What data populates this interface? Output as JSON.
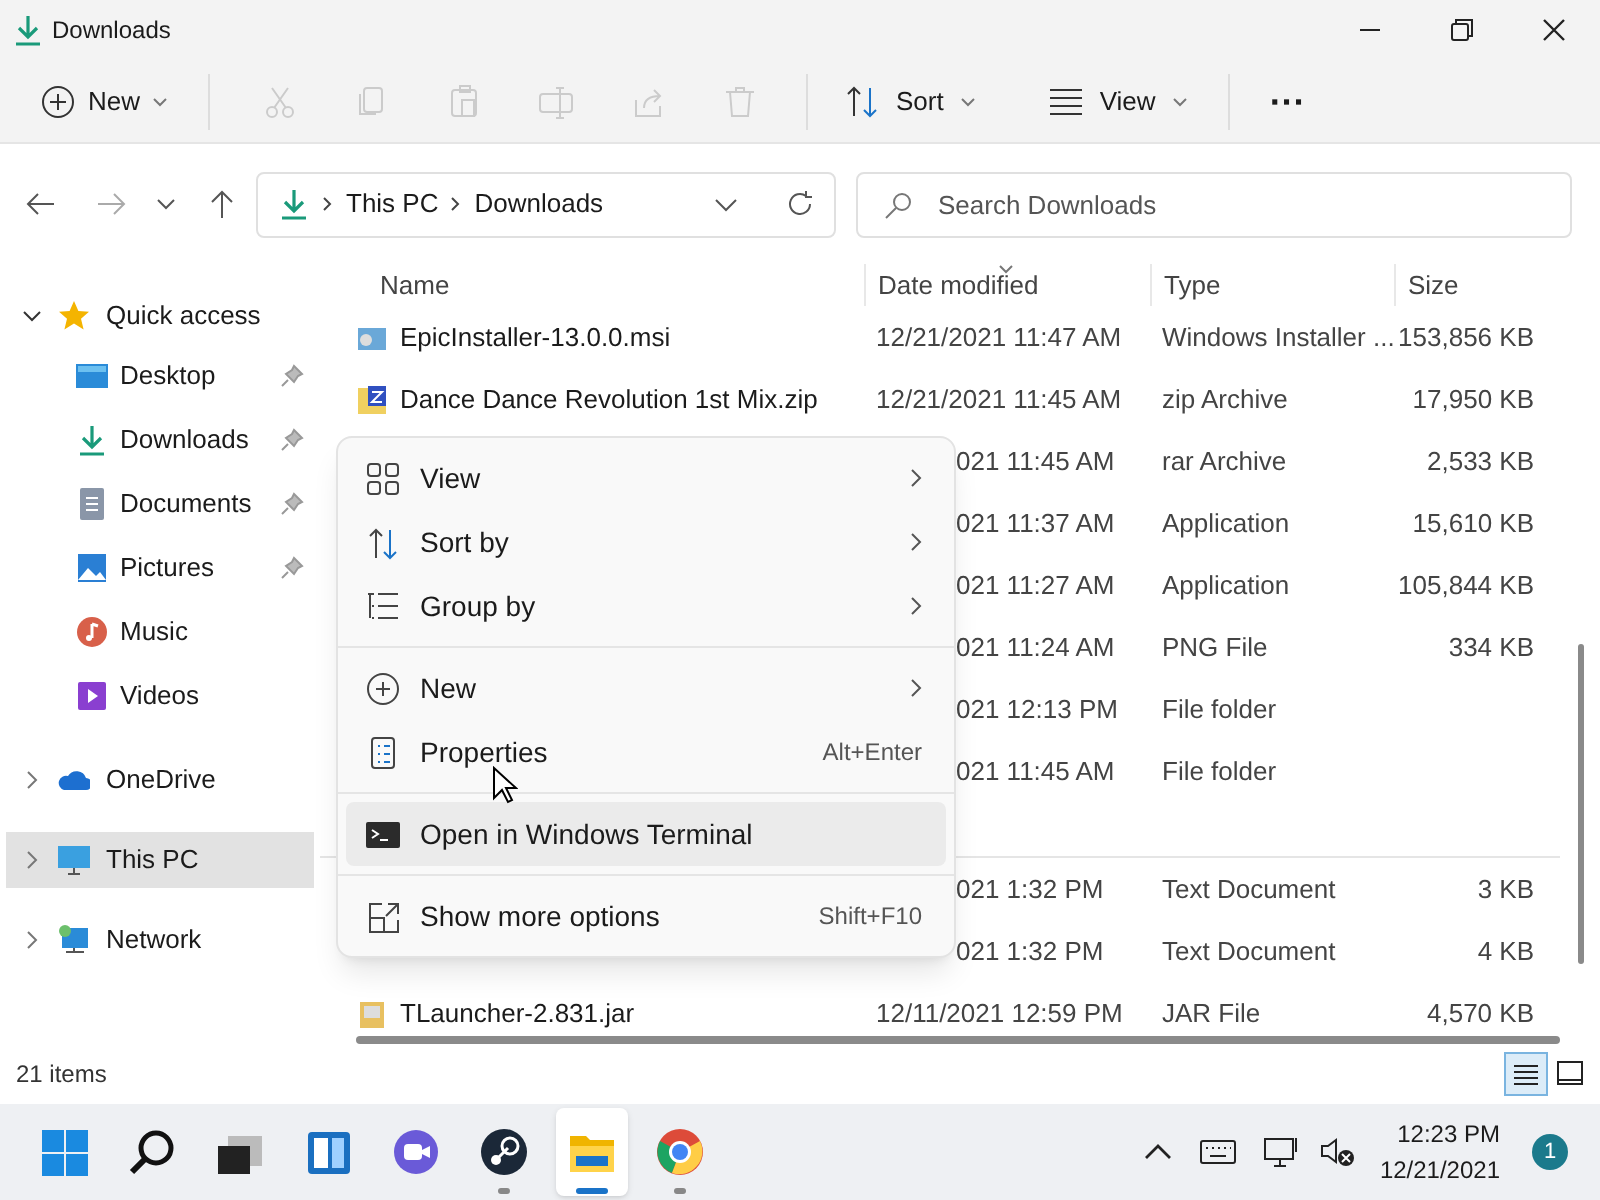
{
  "window": {
    "title": "Downloads"
  },
  "toolbar": [
    {
      "kind": "new",
      "label": "New",
      "disabled": false
    },
    {
      "kind": "icon",
      "disabled": true
    },
    {
      "kind": "icon",
      "disabled": true
    },
    {
      "kind": "icon",
      "disabled": true
    },
    {
      "kind": "icon",
      "disabled": true
    },
    {
      "kind": "icon",
      "disabled": true
    },
    {
      "kind": "icon",
      "disabled": true
    },
    {
      "kind": "sort",
      "label": "Sort",
      "disabled": false
    },
    {
      "kind": "view",
      "label": "View",
      "disabled": false
    },
    {
      "kind": "more",
      "label": "···",
      "disabled": false
    }
  ],
  "address": {
    "crumbs": [
      "This PC",
      "Downloads"
    ],
    "search_placeholder": "Search Downloads"
  },
  "nav": [
    {
      "label": "Quick access",
      "expanded": true,
      "selected": false,
      "children": [
        {
          "label": "Desktop",
          "pinned": true
        },
        {
          "label": "Downloads",
          "pinned": true
        },
        {
          "label": "Documents",
          "pinned": true
        },
        {
          "label": "Pictures",
          "pinned": true
        },
        {
          "label": "Music",
          "pinned": false
        },
        {
          "label": "Videos",
          "pinned": false
        }
      ]
    },
    {
      "label": "OneDrive",
      "expanded": false,
      "selected": false
    },
    {
      "label": "This PC",
      "expanded": false,
      "selected": true
    },
    {
      "label": "Network",
      "expanded": false,
      "selected": false
    }
  ],
  "table": {
    "columns": [
      "Name",
      "Date modified",
      "Type",
      "Size"
    ],
    "rows": [
      {
        "kind": "file",
        "name": "EpicInstaller-13.0.0.msi",
        "date": "12/21/2021 11:47 AM",
        "type": "Windows Installer ...",
        "size": "153,856 KB"
      },
      {
        "kind": "file",
        "name": "Dance Dance Revolution 1st Mix.zip",
        "date": "12/21/2021 11:45 AM",
        "type": "zip Archive",
        "size": "17,950 KB"
      },
      {
        "kind": "covered",
        "date": "021 11:45 AM",
        "type": "rar Archive",
        "size": "2,533 KB"
      },
      {
        "kind": "covered",
        "date": "021 11:37 AM",
        "type": "Application",
        "size": "15,610 KB"
      },
      {
        "kind": "covered",
        "date": "021 11:27 AM",
        "type": "Application",
        "size": "105,844 KB"
      },
      {
        "kind": "covered",
        "date": "021 11:24 AM",
        "type": "PNG File",
        "size": "334 KB"
      },
      {
        "kind": "covered",
        "date": "021 12:13 PM",
        "type": "File folder"
      },
      {
        "kind": "covered",
        "date": "021 11:45 AM",
        "type": "File folder"
      },
      {
        "kind": "group"
      },
      {
        "kind": "covered",
        "date": "021 1:32 PM",
        "type": "Text Document",
        "size": "3 KB"
      },
      {
        "kind": "covered",
        "date": "021 1:32 PM",
        "type": "Text Document",
        "size": "4 KB"
      },
      {
        "kind": "file",
        "name": "TLauncher-2.831.jar",
        "date": "12/11/2021 12:59 PM",
        "type": "JAR File",
        "size": "4,570 KB"
      }
    ]
  },
  "context_menu": {
    "groups": [
      [
        {
          "label": "View",
          "submenu": true,
          "highlighted": false
        },
        {
          "label": "Sort by",
          "submenu": true,
          "highlighted": false
        },
        {
          "label": "Group by",
          "submenu": true,
          "highlighted": false
        }
      ],
      [
        {
          "label": "New",
          "submenu": true,
          "highlighted": false
        },
        {
          "label": "Properties",
          "shortcut": "Alt+Enter",
          "submenu": false,
          "highlighted": false
        }
      ],
      [
        {
          "label": "Open in Windows Terminal",
          "submenu": false,
          "highlighted": true
        }
      ],
      [
        {
          "label": "Show more options",
          "shortcut": "Shift+F10",
          "submenu": false,
          "highlighted": false
        }
      ]
    ]
  },
  "status_bar": {
    "items": "21 items",
    "views": [
      {
        "selected": true
      },
      {
        "selected": false
      }
    ]
  },
  "taskbar": {
    "apps": [
      {
        "running": false,
        "active": false
      },
      {
        "running": false,
        "active": false
      },
      {
        "running": false,
        "active": false
      },
      {
        "running": false,
        "active": false
      },
      {
        "running": false,
        "active": false
      },
      {
        "running": true,
        "active": false
      },
      {
        "running": true,
        "active": true
      },
      {
        "running": true,
        "active": false
      }
    ],
    "time": "12:23 PM",
    "date": "12/21/2021",
    "notifications": "1"
  }
}
